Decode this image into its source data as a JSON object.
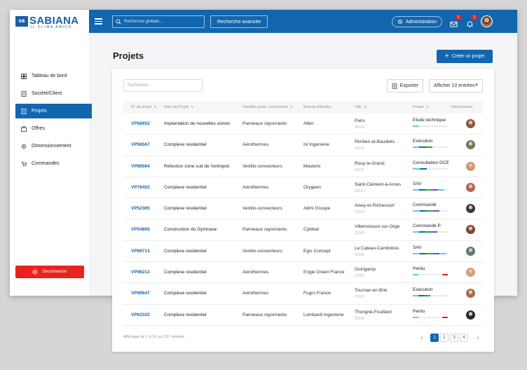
{
  "brand": {
    "name": "SABIANA",
    "tagline": "IL CLIMA AMICO",
    "mark": "SB"
  },
  "topbar": {
    "search_placeholder": "Recherche globale...",
    "advanced_search": "Recherche avancée",
    "admin": "Administration",
    "mail_badge": "1",
    "bell_badge": "1"
  },
  "sidebar": {
    "items": [
      {
        "label": "Tableau de bord",
        "icon": "dashboard-icon",
        "active": false
      },
      {
        "label": "Société/Client",
        "icon": "building-icon",
        "active": false
      },
      {
        "label": "Projets",
        "icon": "document-icon",
        "active": true
      },
      {
        "label": "Offres",
        "icon": "offer-icon",
        "active": false
      },
      {
        "label": "Dimensionnement",
        "icon": "settings-icon",
        "active": false
      },
      {
        "label": "Commandes",
        "icon": "cart-icon",
        "active": false
      }
    ],
    "logout": "Deconnexion"
  },
  "page": {
    "title": "Projets",
    "create_button": "Créer un projet"
  },
  "table": {
    "search_placeholder": "Recherche...",
    "export": "Exporter",
    "entries_select": "Afficher 10 entrées",
    "headers": [
      "N° de projet",
      "Nom du Projet",
      "Familles prod. concernées",
      "Bureau d'études",
      "Ville",
      "Phase",
      "Interlocuteur"
    ],
    "rows": [
      {
        "num": "VP56652",
        "name": "Implantation de nouvelles usines",
        "family": "Panneaux rayonnants",
        "bureau": "Alten",
        "city": "Paris",
        "zip": "94100",
        "phase": "Etude technique",
        "progress": 0.15,
        "avatar": "#8b5a3c"
      },
      {
        "num": "VP56567",
        "name": "Complexe residentiel",
        "family": "Aérothermes",
        "bureau": "Isl Ingenierie",
        "city": "Rimbez-et-Baudiets",
        "zip": "46100",
        "phase": "Exécution",
        "progress": 0.55,
        "avatar": "#6a7a5a"
      },
      {
        "num": "VP89564",
        "name": "Refection zone sud de l'entrepot",
        "family": "Ventilo-convecteurs",
        "bureau": "Masteris",
        "city": "Rouy-le-Grand",
        "zip": "80110",
        "phase": "Consultation DCE",
        "progress": 0.4,
        "avatar": "#c89a7a"
      },
      {
        "num": "VP78452",
        "name": "Complexe residentiel",
        "family": "Aérothermes",
        "bureau": "Orygeen",
        "city": "Saint-Clément-à-Arnes",
        "zip": "08310",
        "phase": "SAV",
        "progress": 0.9,
        "avatar": "#b0684a"
      },
      {
        "num": "VP52365",
        "name": "Complexe residentiel",
        "family": "Ventilo-convecteurs",
        "bureau": "Abmi Groupe",
        "city": "Aisey-et-Richecourt",
        "zip": "70500",
        "phase": "Commandé",
        "progress": 0.75,
        "avatar": "#3a3a3a"
      },
      {
        "num": "VP54865",
        "name": "Construction du Gymnase",
        "family": "Panneaux rayonnants",
        "bureau": "Cylébat",
        "city": "Villemoisson-sur-Orge",
        "zip": "91360",
        "phase": "Commandé P.",
        "progress": 0.7,
        "avatar": "#7a4a3a"
      },
      {
        "num": "VP89713",
        "name": "Complexe residentiel",
        "family": "Ventilo-convecteurs",
        "bureau": "Egis Concept",
        "city": "Le Cateau-Cambrésis",
        "zip": "59360",
        "phase": "SAV",
        "progress": 0.95,
        "avatar": "#5a7a7a"
      },
      {
        "num": "VP96213",
        "name": "Complexe residentiel",
        "family": "Aérothermes",
        "bureau": "Engie Green France",
        "city": "Guingamp",
        "zip": "22200",
        "phase": "Perdu",
        "progress": 0.1,
        "avatar": "#d0a080"
      },
      {
        "num": "VP99647",
        "name": "Complexe residentiel",
        "family": "Aérothermes",
        "bureau": "Fugro France",
        "city": "Tournan-en-Brie",
        "zip": "22200",
        "phase": "Exécution",
        "progress": 0.5,
        "avatar": "#a86a4a"
      },
      {
        "num": "VP63325",
        "name": "Complexe residentiel",
        "family": "Panneaux rayonnants",
        "bureau": "Lombardi Ingenierie",
        "city": "Thorigné-Fouillard",
        "zip": "35235",
        "phase": "Perdu",
        "progress": 0.1,
        "avatar": "#2a2a2a"
      }
    ],
    "footer": "Affichage de 1 à 10 sur 157 entrées",
    "pages": [
      "1",
      "2",
      "3",
      "4"
    ],
    "prev": "‹",
    "next": "›"
  }
}
